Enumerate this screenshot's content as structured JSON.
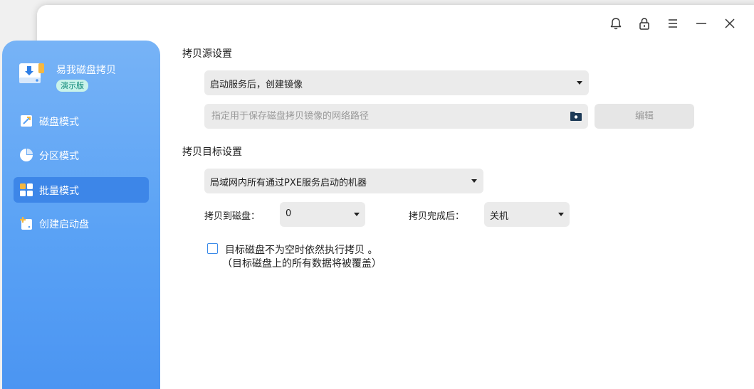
{
  "app": {
    "name": "易我磁盘拷贝",
    "badge": "演示版"
  },
  "sidebar": {
    "items": [
      {
        "label": "磁盘模式",
        "icon": "disk-mode-icon",
        "active": false
      },
      {
        "label": "分区模式",
        "icon": "pie-chart-icon",
        "active": false
      },
      {
        "label": "批量模式",
        "icon": "grid-icon",
        "active": true
      },
      {
        "label": "创建启动盘",
        "icon": "boot-disk-plus-icon",
        "active": false
      }
    ]
  },
  "titlebar": {
    "icons": [
      "bell-icon",
      "lock-icon",
      "menu-icon",
      "minimize-icon",
      "close-icon"
    ]
  },
  "source": {
    "title": "拷贝源设置",
    "mode": "启动服务后，创建镜像",
    "path_placeholder": "指定用于保存磁盘拷贝镜像的网络路径",
    "path_value": "",
    "edit_label": "编辑"
  },
  "target": {
    "title": "拷贝目标设置",
    "machines": "局域网内所有通过PXE服务启动的机器",
    "disk_label": "拷贝到磁盘：",
    "disk_value": "0",
    "after_label": "拷贝完成后：",
    "after_value": "关机",
    "checkbox_checked": false,
    "checkbox_line1": "目标磁盘不为空时依然执行拷贝 。",
    "checkbox_line2": "（目标磁盘上的所有数据将被覆盖）"
  },
  "colors": {
    "sidebar_top": "#77b3f6",
    "sidebar_bottom": "#4b95f2",
    "active_item": "#3d86e8",
    "checkbox_border": "#3a8ae8"
  }
}
